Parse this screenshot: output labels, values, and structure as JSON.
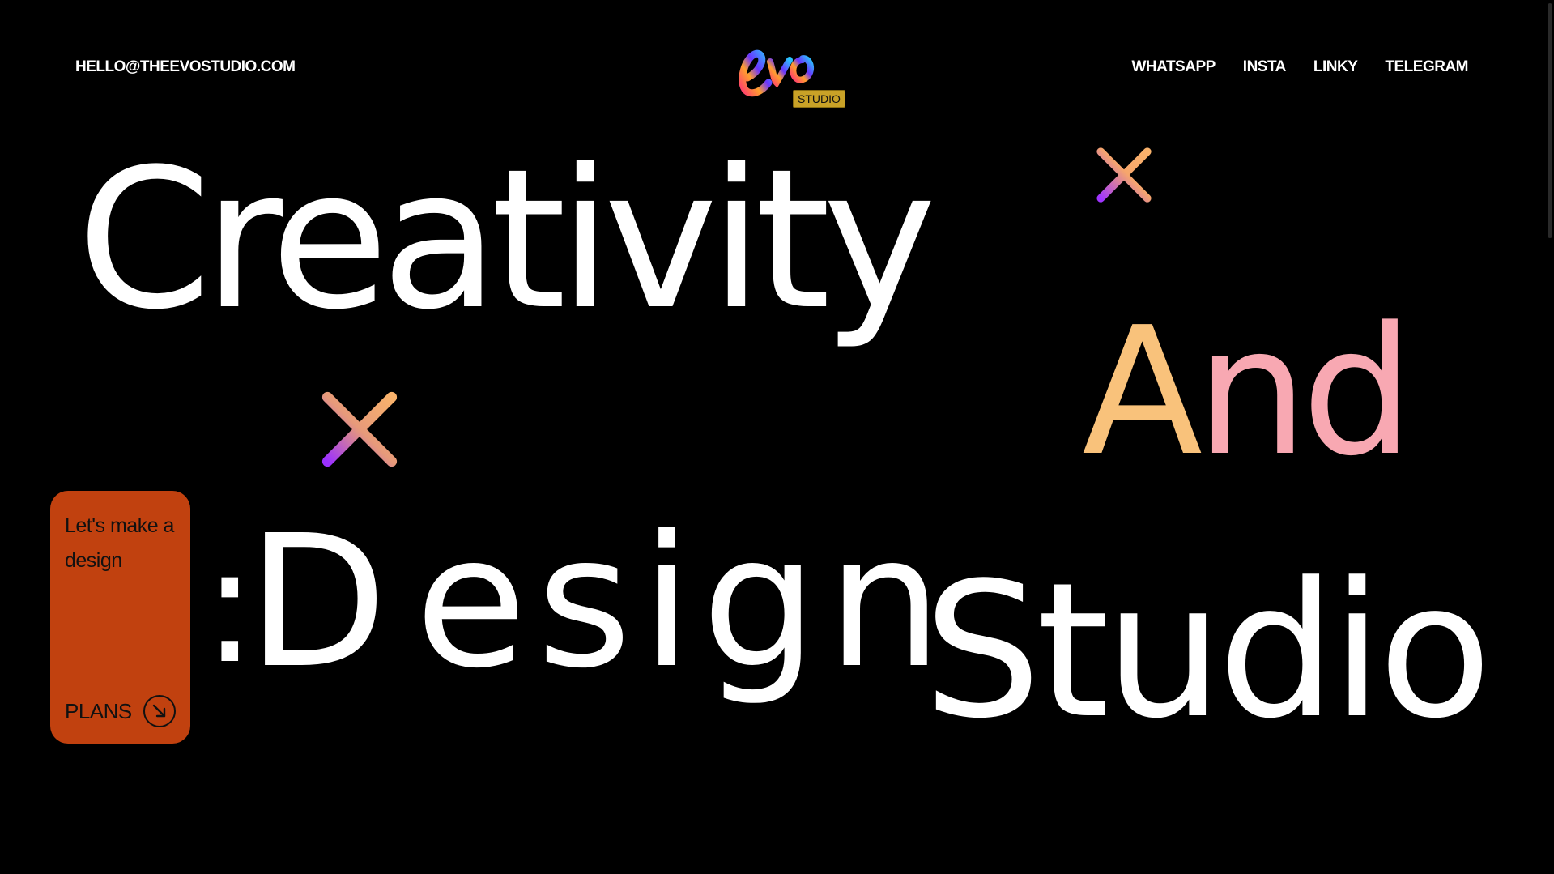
{
  "header": {
    "email": "HELLO@THEEVOSTUDIO.COM",
    "logo": {
      "script_text": "evo",
      "badge": "STUDIO"
    },
    "nav": [
      {
        "label": "WHATSAPP"
      },
      {
        "label": "INSTA"
      },
      {
        "label": "LINKY"
      },
      {
        "label": "TELEGRAM"
      }
    ]
  },
  "hero": {
    "word1": "Creativity",
    "word2_first": "A",
    "word2_rest": "nd",
    "colon": ":",
    "word3_first": "D",
    "word3_rest": "esign",
    "word4": "Studio"
  },
  "card": {
    "text": "Let's make a design",
    "plans_label": "PLANS",
    "arrow_icon": "arrow-down-right-icon"
  },
  "colors": {
    "background": "#000000",
    "text": "#ffffff",
    "card": "#c1410f",
    "and_a": "#f9c27b",
    "and_nd": "#f8a8b2",
    "logo_badge": "#c9a227",
    "star_gradient": [
      "#a035ff",
      "#f9b26b"
    ]
  },
  "icons": {
    "star": "asterisk-star-icon"
  }
}
